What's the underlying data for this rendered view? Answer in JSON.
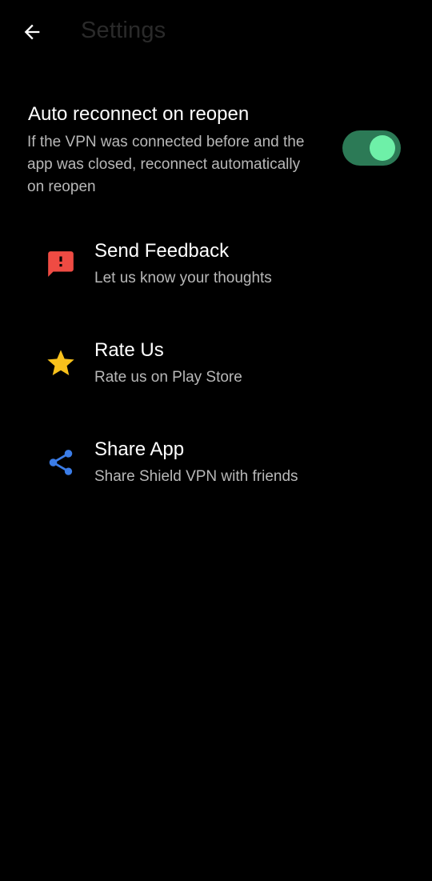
{
  "header": {
    "title": "Settings",
    "back_icon": "arrow-left-icon"
  },
  "auto_reconnect": {
    "title": "Auto reconnect on reopen",
    "description": "If the VPN was connected before and the app was closed, reconnect automatically on reopen",
    "enabled": true
  },
  "items": [
    {
      "title": "Send Feedback",
      "subtitle": "Let us know your thoughts",
      "icon": "feedback-icon",
      "icon_color": "#ef4b43"
    },
    {
      "title": "Rate Us",
      "subtitle": "Rate us on Play Store",
      "icon": "star-icon",
      "icon_color": "#f8c11c"
    },
    {
      "title": "Share App",
      "subtitle": "Share Shield VPN with friends",
      "icon": "share-icon",
      "icon_color": "#3b7de8"
    }
  ],
  "colors": {
    "background": "#000000",
    "switch_track": "#2c7a56",
    "switch_knob": "#6ef0a8",
    "secondary_text": "#b8b8b8"
  }
}
